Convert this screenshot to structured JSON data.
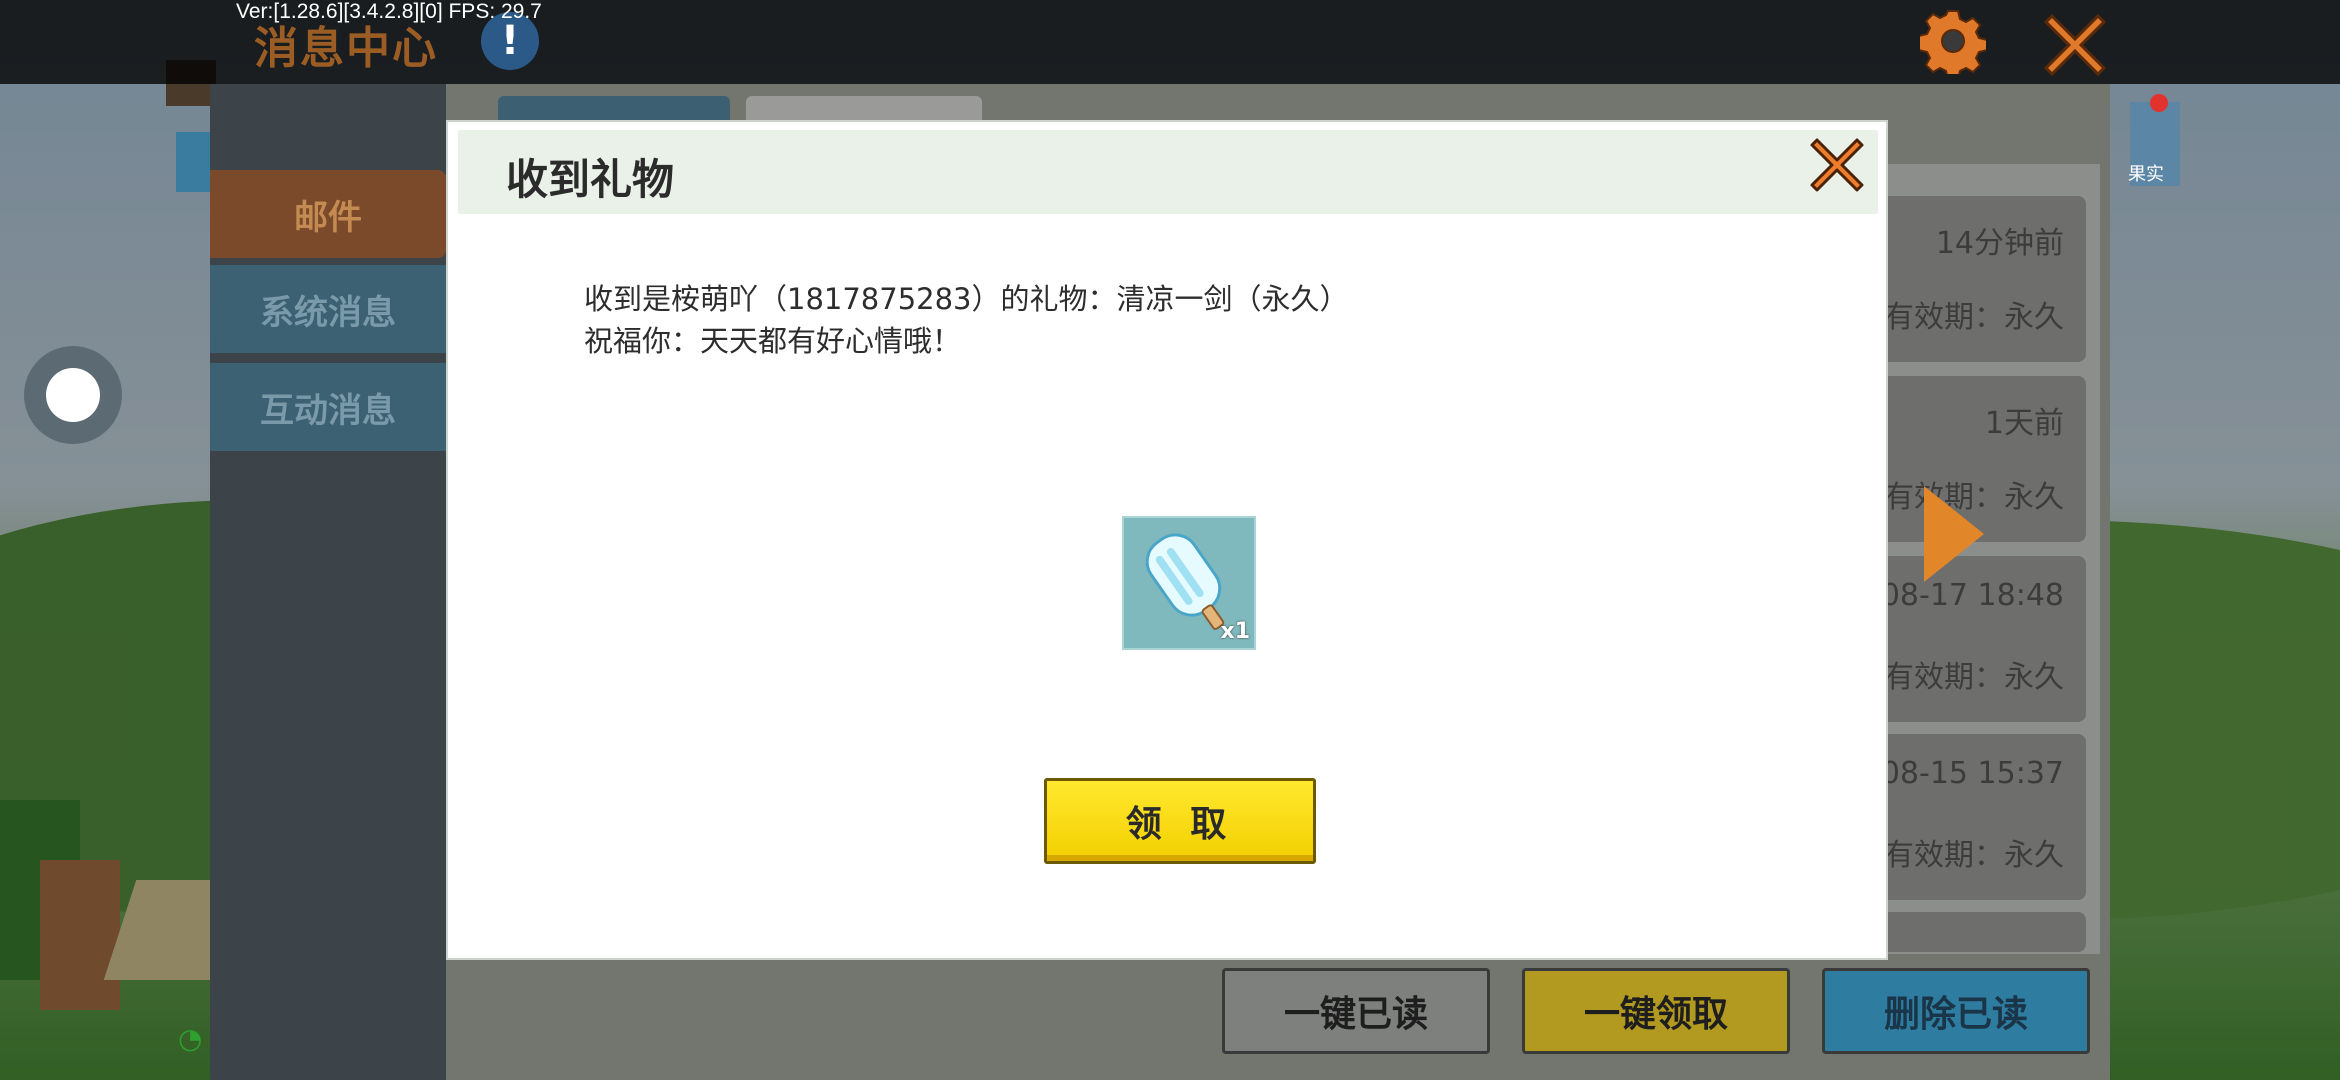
{
  "debug": {
    "text": "Ver:[1.28.6][3.4.2.8][0] FPS: 29.7"
  },
  "header": {
    "title": "消息中心",
    "info_glyph": "!",
    "settings_icon": "gear-icon",
    "close_icon": "close-icon"
  },
  "sidebar": {
    "items": [
      {
        "label": "邮件"
      },
      {
        "label": "系统消息"
      },
      {
        "label": "互动消息"
      }
    ]
  },
  "messages": [
    {
      "time": "14分钟前",
      "expiry": "有效期：永久"
    },
    {
      "time": "1天前",
      "expiry": "有效期：永久"
    },
    {
      "time": "08-17 18:48",
      "expiry": "有效期：永久"
    },
    {
      "time": "08-15 15:37",
      "expiry": "有效期：永久"
    }
  ],
  "footer": {
    "mark_read": "一键已读",
    "claim_all": "一键领取",
    "delete_read": "删除已读"
  },
  "right_item": {
    "label": "果实"
  },
  "modal": {
    "title": "收到礼物",
    "line1": "收到是桉萌吖（1817875283）的礼物：清凉一剑（永久）",
    "line2": "祝福你：天天都有好心情哦！",
    "item_count": "x1",
    "claim_button": "领 取"
  },
  "colors": {
    "claim_yellow": "#ffe92e",
    "close_orange": "#e8792a",
    "header_brown": "#9b5d24"
  }
}
